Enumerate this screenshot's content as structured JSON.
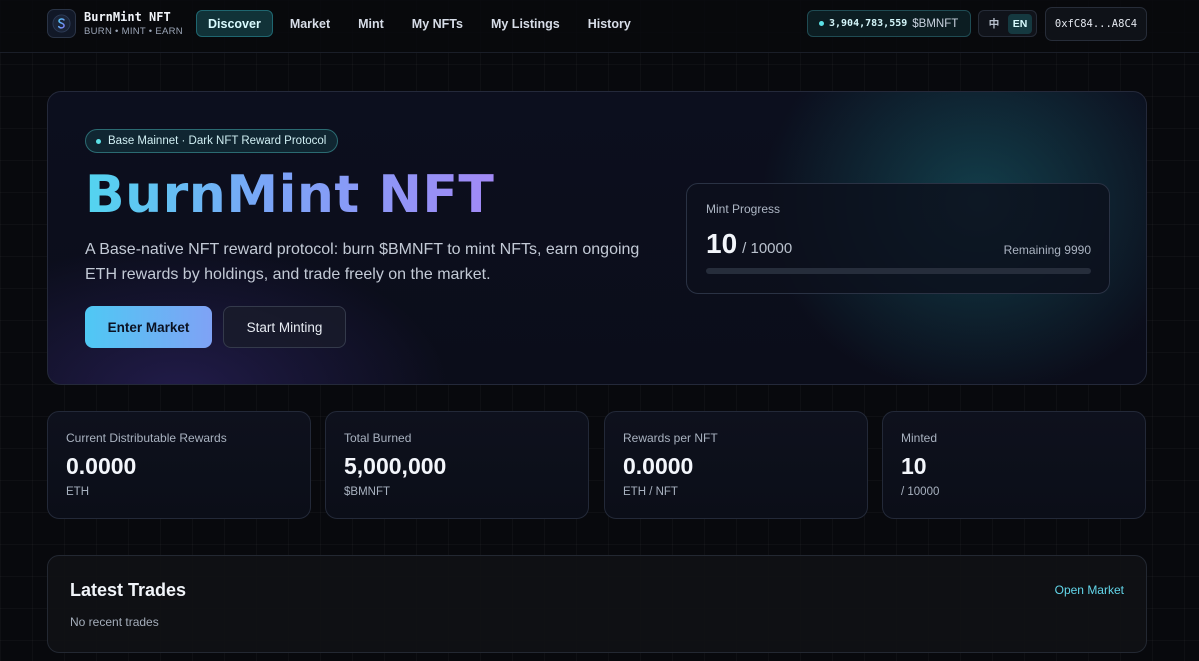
{
  "brand": {
    "name": "BurnMint NFT",
    "tagline": "BURN • MINT • EARN",
    "logo_icon": "flame-dollar-icon"
  },
  "nav": {
    "items": [
      {
        "label": "Discover",
        "active": true
      },
      {
        "label": "Market",
        "active": false
      },
      {
        "label": "Mint",
        "active": false
      },
      {
        "label": "My NFTs",
        "active": false
      },
      {
        "label": "My Listings",
        "active": false
      },
      {
        "label": "History",
        "active": false
      }
    ]
  },
  "header": {
    "balance_amount": "3,904,783,559",
    "balance_symbol": "$BMNFT",
    "lang_zh": "中",
    "lang_en": "EN",
    "lang_active": "EN",
    "wallet": "0xfC84...A8C4"
  },
  "hero": {
    "badge": "Base Mainnet · Dark NFT Reward Protocol",
    "title": "BurnMint NFT",
    "description": "A Base-native NFT reward protocol: burn $BMNFT to mint NFTs, earn ongoing ETH rewards by holdings, and trade freely on the market.",
    "primary_button": "Enter Market",
    "secondary_button": "Start Minting"
  },
  "mint_progress": {
    "label": "Mint Progress",
    "current": "10",
    "total": "/ 10000",
    "remaining": "Remaining 9990",
    "fraction": 0.001
  },
  "stats": [
    {
      "label": "Current Distributable Rewards",
      "value": "0.0000",
      "unit": "ETH"
    },
    {
      "label": "Total Burned",
      "value": "5,000,000",
      "unit": "$BMNFT"
    },
    {
      "label": "Rewards per NFT",
      "value": "0.0000",
      "unit": "ETH / NFT"
    },
    {
      "label": "Minted",
      "value": "10",
      "unit": "/ 10000"
    }
  ],
  "latest_trades": {
    "title": "Latest Trades",
    "link": "Open Market",
    "empty": "No recent trades"
  },
  "colors": {
    "accent_teal": "#5ce1e6",
    "gradient_start": "#53d5f0",
    "gradient_end": "#a289f6",
    "background": "#08090d"
  }
}
